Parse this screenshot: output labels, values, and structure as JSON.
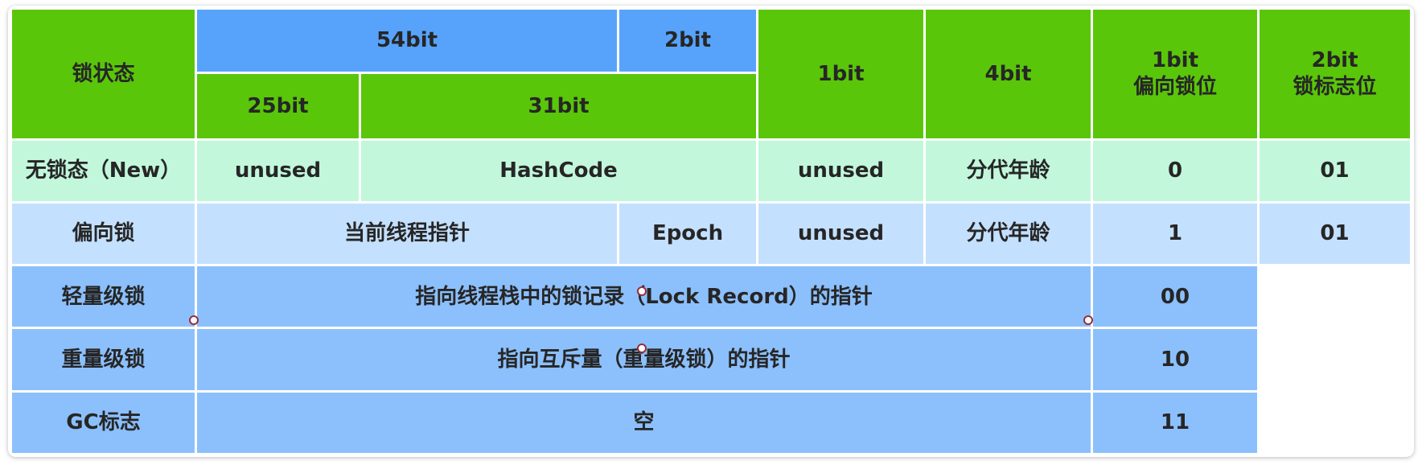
{
  "header": {
    "lock_state": "锁状态",
    "bits_54": "54bit",
    "bits_2_epoch": "2bit",
    "bits_25": "25bit",
    "bits_31": "31bit",
    "bits_1": "1bit",
    "bits_4": "4bit",
    "biased_bit_size": "1bit",
    "biased_bit_label": "偏向锁位",
    "flag_bit_size": "2bit",
    "flag_bit_label": "锁标志位"
  },
  "rows": {
    "unlocked": {
      "state": "无锁态（New）",
      "unused_25": "unused",
      "hashcode": "HashCode",
      "unused_1": "unused",
      "age": "分代年龄",
      "biased": "0",
      "flag": "01"
    },
    "biased": {
      "state": "偏向锁",
      "thread_pointer": "当前线程指针",
      "epoch": "Epoch",
      "unused_1": "unused",
      "age": "分代年龄",
      "biased": "1",
      "flag": "01"
    },
    "lightweight": {
      "state": "轻量级锁",
      "content": "指向线程栈中的锁记录（Lock Record）的指针",
      "flag": "00"
    },
    "heavyweight": {
      "state": "重量级锁",
      "content": "指向互斥量（重量级锁）的指针",
      "flag": "10"
    },
    "gc": {
      "state": "GC标志",
      "content": "空",
      "flag": "11"
    }
  },
  "colors": {
    "header_green": "#5ac60a",
    "header_blue": "#57a3fc",
    "row_mint": "#c2f7dc",
    "row_light_blue": "#c4e0ff",
    "row_steel_blue": "#8cc0fc",
    "handle_outline": "#9a2d3a"
  }
}
